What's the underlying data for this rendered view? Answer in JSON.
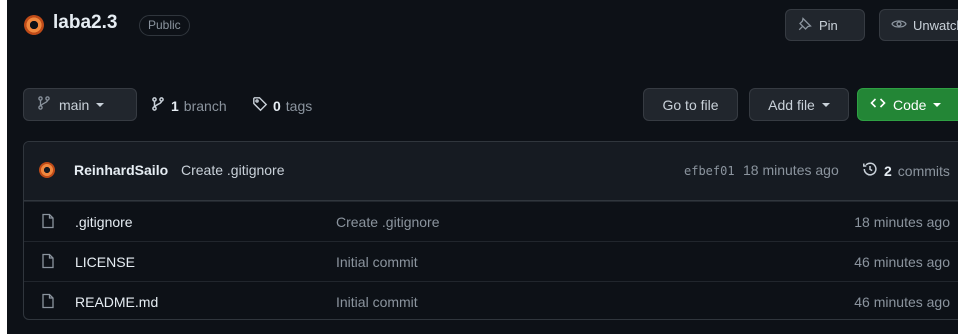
{
  "repo": {
    "name": "laba2.3",
    "visibility": "Public",
    "pin_label": "Pin",
    "unwatch_label": "Unwatch"
  },
  "toolbar": {
    "branch": "main",
    "branch_count": "1",
    "branch_word": "branch",
    "tag_count": "0",
    "tag_word": "tags",
    "go_to_file": "Go to file",
    "add_file": "Add file",
    "code": "Code"
  },
  "latest_commit": {
    "author": "ReinhardSailo",
    "message": "Create .gitignore",
    "hash": "efbef01",
    "time": "18 minutes ago",
    "commit_count": "2",
    "commit_word": "commits"
  },
  "files": [
    {
      "name": ".gitignore",
      "commit": "Create .gitignore",
      "age": "18 minutes ago"
    },
    {
      "name": "LICENSE",
      "commit": "Initial commit",
      "age": "46 minutes ago"
    },
    {
      "name": "README.md",
      "commit": "Initial commit",
      "age": "46 minutes ago"
    }
  ],
  "colors": {
    "background": "#0d1117",
    "code_button": "#238636",
    "muted_text": "#8b949e"
  },
  "icons": [
    "repo-avatar-icon",
    "pin-icon",
    "eye-icon",
    "git-branch-icon",
    "tag-icon",
    "code-icon",
    "history-icon",
    "file-icon"
  ]
}
